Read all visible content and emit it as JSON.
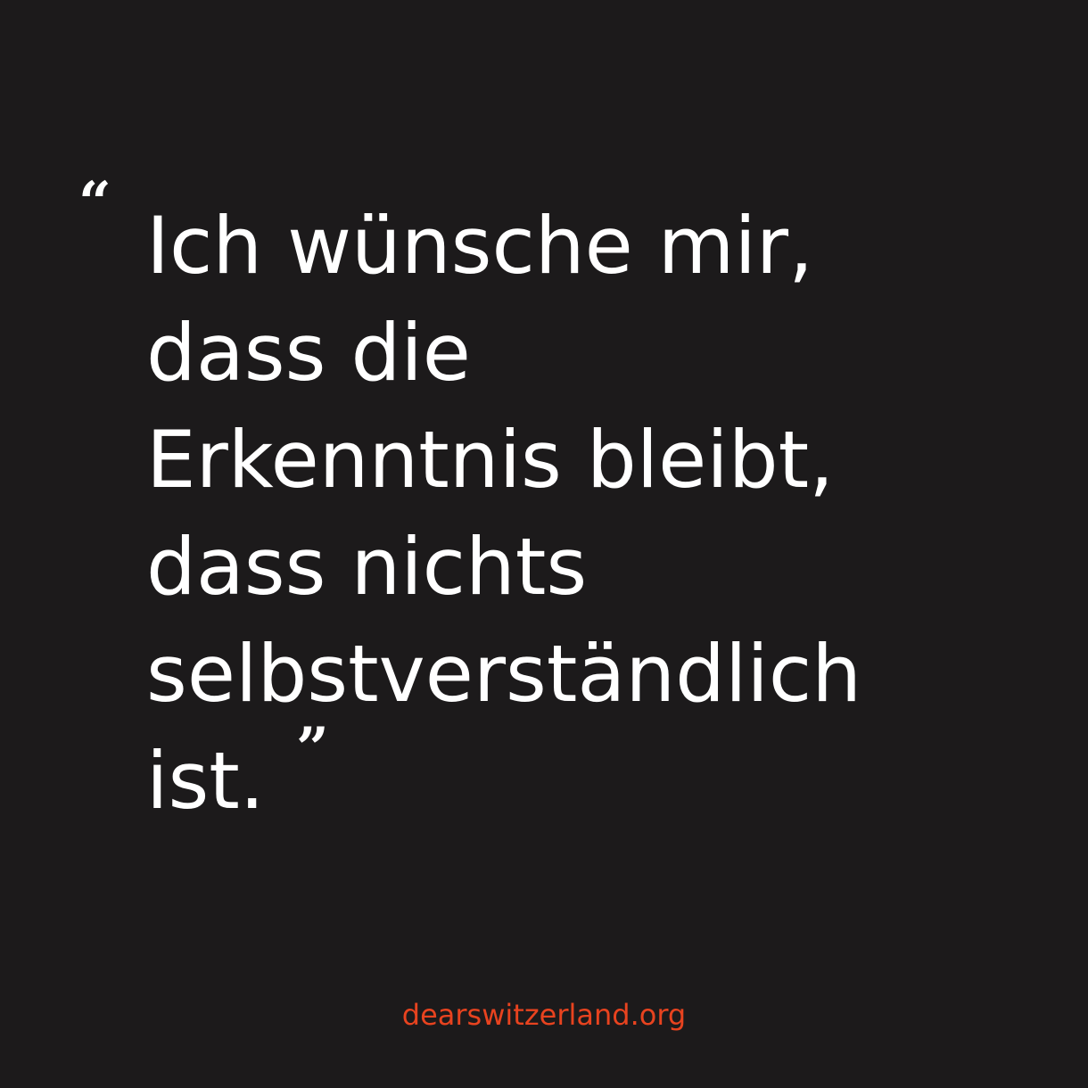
{
  "quote": {
    "open_mark": "“",
    "close_mark": "”",
    "lines": [
      "Ich wünsche mir,",
      "dass die",
      "Erkenntnis bleibt,",
      "dass nichts",
      "selbstverständlich",
      "ist."
    ]
  },
  "footer": {
    "website": "dearswitzerland.org"
  },
  "colors": {
    "background": "#1c1a1b",
    "text": "#ffffff",
    "accent": "#e8431f"
  }
}
